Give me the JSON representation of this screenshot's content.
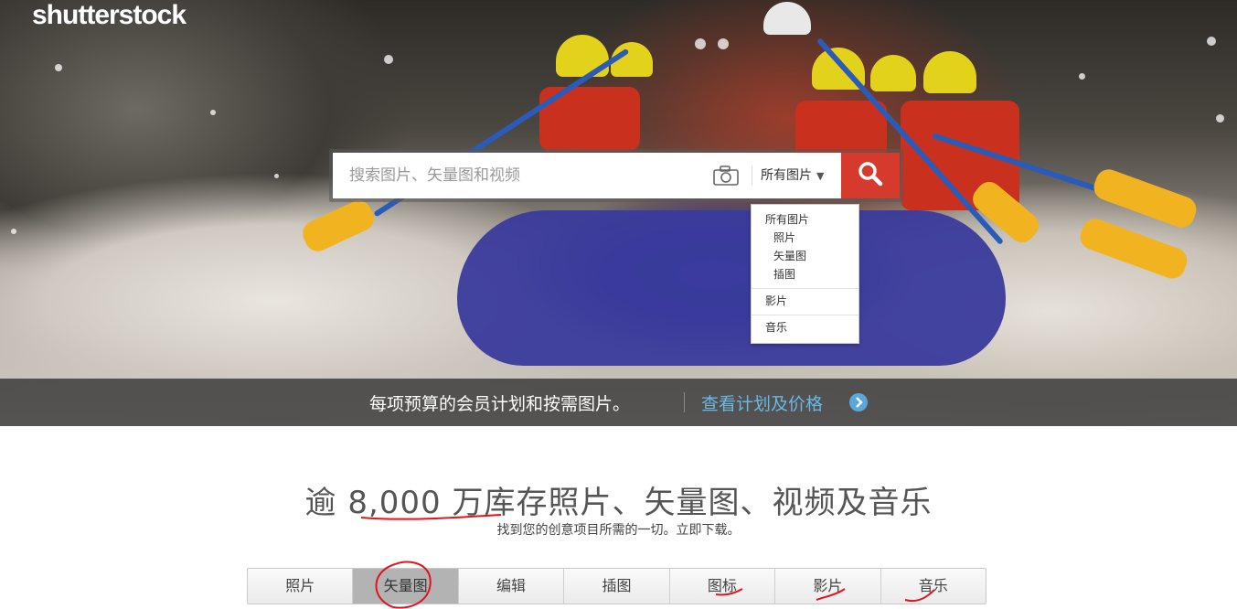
{
  "brand": {
    "logo_text": "shutterstock"
  },
  "search": {
    "placeholder": "搜索图片、矢量图和视频",
    "selected_type": "所有图片",
    "camera_icon": "camera-icon",
    "search_icon": "search-icon"
  },
  "dropdown": {
    "items": [
      "所有图片",
      "照片",
      "矢量图",
      "插图",
      "影片",
      "音乐"
    ]
  },
  "promo": {
    "text": "每项预算的会员计划和按需图片。",
    "link": "查看计划及价格"
  },
  "main": {
    "headline": "逾 8,000 万库存照片、矢量图、视频及音乐",
    "subline": "找到您的创意项目所需的一切。立即下载。"
  },
  "tabs": [
    {
      "label": "照片"
    },
    {
      "label": "矢量图"
    },
    {
      "label": "编辑"
    },
    {
      "label": "插图"
    },
    {
      "label": "图标"
    },
    {
      "label": "影片"
    },
    {
      "label": "音乐"
    }
  ],
  "colors": {
    "search_button": "#d63a2c",
    "promo_link": "#68b8e8",
    "annotation_red": "#e0141e"
  }
}
